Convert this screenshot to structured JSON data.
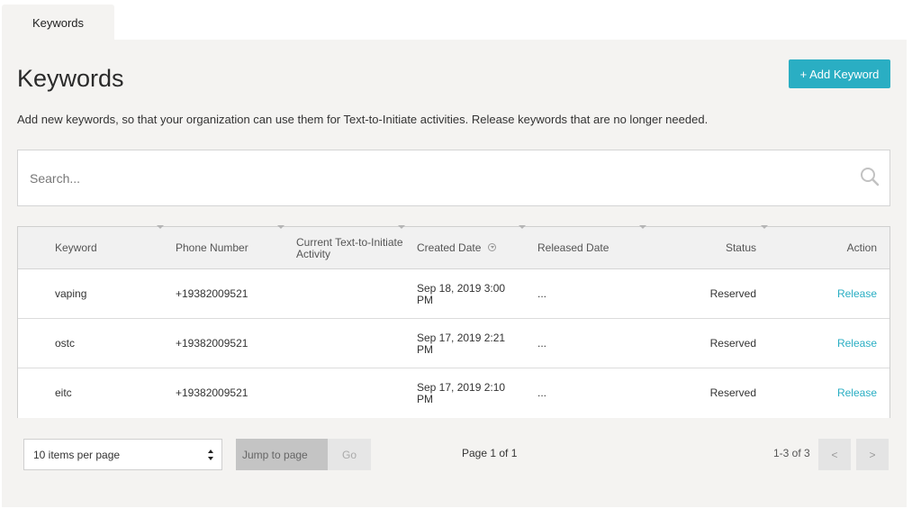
{
  "tabs": [
    {
      "label": "Keywords"
    }
  ],
  "header": {
    "title": "Keywords",
    "add_button": "+ Add Keyword",
    "description": "Add new keywords, so that your organization can use them for Text-to-Initiate activities. Release keywords that are no longer needed."
  },
  "search": {
    "placeholder": "Search...",
    "icon": "search-icon"
  },
  "table": {
    "columns": [
      "Keyword",
      "Phone Number",
      "Current Text-to-Initiate Activity",
      "Created Date",
      "Released Date",
      "Status",
      "Action"
    ],
    "rows": [
      {
        "keyword": "vaping",
        "phone": "+19382009521",
        "activity": "",
        "created": "Sep 18, 2019 3:00 PM",
        "released": "...",
        "status": "Reserved",
        "action": "Release"
      },
      {
        "keyword": "ostc",
        "phone": "+19382009521",
        "activity": "",
        "created": "Sep 17, 2019 2:21 PM",
        "released": "...",
        "status": "Reserved",
        "action": "Release"
      },
      {
        "keyword": "eitc",
        "phone": "+19382009521",
        "activity": "",
        "created": "Sep 17, 2019 2:10 PM",
        "released": "...",
        "status": "Reserved",
        "action": "Release"
      }
    ]
  },
  "pagination": {
    "items_per_page": "10 items per page",
    "jump_placeholder": "Jump to page",
    "go_label": "Go",
    "page_info": "Page 1 of 1",
    "range_info": "1-3 of 3",
    "prev_label": "<",
    "next_label": ">"
  },
  "colors": {
    "accent": "#2aaec3",
    "panel_bg": "#f4f3f1"
  }
}
